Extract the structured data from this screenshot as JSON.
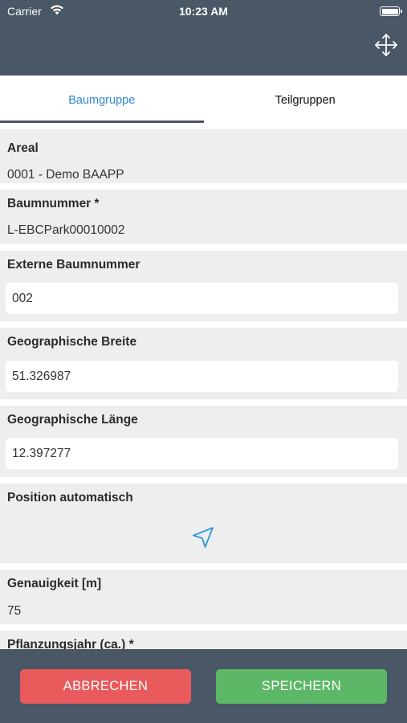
{
  "status_bar": {
    "carrier": "Carrier",
    "time": "10:23 AM",
    "wifi_icon": "wifi-icon",
    "battery_icon": "battery-icon"
  },
  "nav": {
    "icon": "move-arrows-icon"
  },
  "tabs": [
    {
      "label": "Baumgruppe",
      "active": true
    },
    {
      "label": "Teilgruppen",
      "active": false
    }
  ],
  "fields": {
    "areal": {
      "label": "Areal",
      "value": "0001 - Demo BAAPP"
    },
    "baumnummer": {
      "label": "Baumnummer *",
      "value": "L-EBCPark00010002"
    },
    "externe_baumnummer": {
      "label": "Externe Baumnummer",
      "value": "002"
    },
    "breite": {
      "label": "Geographische  Breite",
      "value": "51.326987"
    },
    "laenge": {
      "label": "Geographische  Länge",
      "value": "12.397277"
    },
    "position": {
      "label": "Position automatisch",
      "icon": "location-arrow-icon"
    },
    "genauigkeit": {
      "label": "Genauigkeit [m]",
      "value": "75"
    },
    "pflanzungsjahr": {
      "label": "Pflanzungsjahr (ca.) *"
    }
  },
  "footer": {
    "cancel_label": "ABBRECHEN",
    "save_label": "SPEICHERN"
  },
  "colors": {
    "header": "#4a5766",
    "accent": "#2f87d4",
    "cancel": "#e85a5c",
    "save": "#5cb767",
    "section_bg": "#eeeeef"
  }
}
